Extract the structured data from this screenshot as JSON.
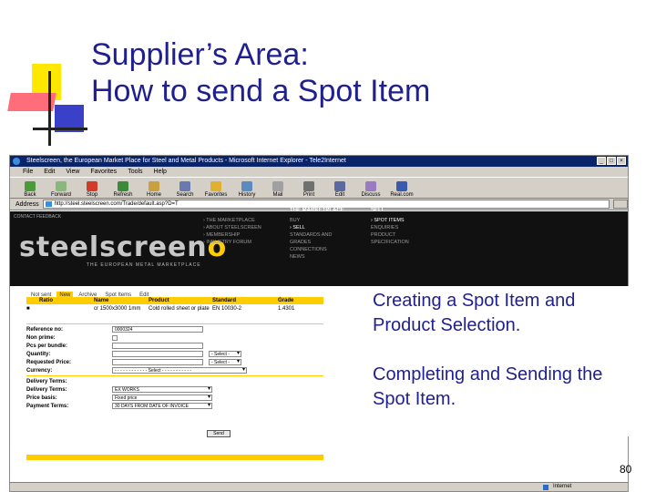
{
  "slide": {
    "title_line1": "Supplier’s Area:",
    "title_line2": "How to send a Spot Item",
    "caption1": "Creating a Spot Item and Product Selection.",
    "caption2": "Completing and Sending the Spot Item.",
    "page_number": "80"
  },
  "browser": {
    "window_title": "Steelscreen, the European Market Place for Steel and Metal Products - Microsoft Internet Explorer - Tele2Internet",
    "menu": [
      "File",
      "Edit",
      "View",
      "Favorites",
      "Tools",
      "Help"
    ],
    "toolbar": [
      {
        "label": "Back",
        "icon": "back-arrow-icon"
      },
      {
        "label": "Forward",
        "icon": "forward-arrow-icon"
      },
      {
        "label": "Stop",
        "icon": "stop-icon"
      },
      {
        "label": "Refresh",
        "icon": "refresh-icon"
      },
      {
        "label": "Home",
        "icon": "home-icon"
      },
      {
        "label": "Search",
        "icon": "search-icon"
      },
      {
        "label": "Favorites",
        "icon": "favorites-icon"
      },
      {
        "label": "History",
        "icon": "history-icon"
      },
      {
        "label": "Mail",
        "icon": "mail-icon"
      },
      {
        "label": "Print",
        "icon": "print-icon"
      },
      {
        "label": "Edit",
        "icon": "edit-icon"
      },
      {
        "label": "Discuss",
        "icon": "discuss-icon"
      },
      {
        "label": "Real.com",
        "icon": "real-icon"
      }
    ],
    "address_label": "Address",
    "address_url": "http://steel.steelscreen.com/Trade/default.asp?D=T",
    "status_text": "Internet"
  },
  "site": {
    "top_links": "CONTACT   FEEDBACK",
    "logo_text": "steelscreen",
    "logo_o": "o",
    "tagline": "THE EUROPEAN METAL MARKETPLACE",
    "nav_left": [
      "› THE MARKETPLACE",
      "› ABOUT STEELSCREEN",
      "› MEMBERSHIP",
      "› INDUSTRY FORUM"
    ],
    "nav_head_mid": "THE MARKETPLACE",
    "nav_mid": [
      "BUY",
      "› SELL",
      "STANDARDS AND GRADES",
      "CONNECTIONS",
      "NEWS"
    ],
    "nav_head_right": "SELL",
    "nav_right": [
      "› SPOT ITEMS",
      "ENQUIRIES",
      "PRODUCT",
      "SPECIFICATION"
    ]
  },
  "tabs": [
    "Not sent",
    "New",
    "Archive",
    "Spot Items",
    "Edit"
  ],
  "grid": {
    "headers": [
      "",
      "Ratio",
      "Name",
      "Product",
      "Standard",
      "Grade"
    ],
    "row": [
      "■",
      "",
      "cr 1500x3000 1mm",
      "Cold rolled sheet or plate",
      "EN 10030-2",
      "1.4301"
    ]
  },
  "form": {
    "reference_label": "Reference no:",
    "reference_value": "0000324",
    "non_prime_label": "Non prime:",
    "pcs_label": "Pcs per bundle:",
    "quantity_label": "Quantity:",
    "select_text": "- Select -",
    "requested_label": "Requested Price:",
    "currency_label": "Currency:",
    "currency_select": "- - - - - - - - - - - - Select - - - - - - - - - - -",
    "delivery_section": "Delivery Terms:",
    "delivery_terms_label": "Delivery Terms:",
    "delivery_terms_value": "EX WORKS",
    "price_basis_label": "Price basis:",
    "price_basis_value": "Fixed price",
    "payment_terms_label": "Payment Terms:",
    "payment_terms_value": "30 DAYS FROM DATE OF INVOICE",
    "send_label": "Send"
  }
}
